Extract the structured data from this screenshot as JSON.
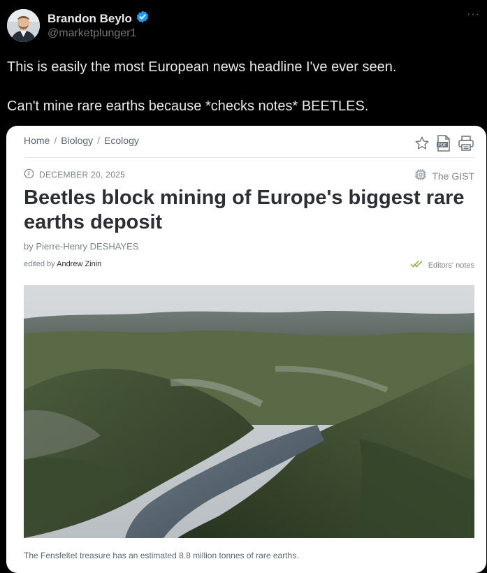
{
  "tweet": {
    "display_name": "Brandon Beylo",
    "handle": "@marketplunger1",
    "verified_icon": "verified-badge-icon",
    "more_icon": "more-options-icon",
    "text_line1": "This is easily the most European news headline I've ever seen.",
    "text_line2": "Can't mine rare earths because *checks notes* BEETLES."
  },
  "article": {
    "breadcrumb": [
      "Home",
      "Biology",
      "Ecology"
    ],
    "breadcrumb_sep": "/",
    "icons": [
      "star-icon",
      "pdf-icon",
      "print-icon"
    ],
    "date": "DECEMBER 20, 2025",
    "gist_label": "The GIST",
    "headline": "Beetles block mining of Europe's biggest rare earths deposit",
    "byline": "by Pierre-Henry DESHAYES",
    "edited_by_label": "edited by",
    "editor": "Andrew Zinin",
    "editors_notes": "Editors' notes",
    "caption": "The Fensfeltet treasure has an estimated 8.8 million tonnes of rare earths."
  },
  "colors": {
    "background": "#000000",
    "text_primary": "#e7e9ea",
    "text_secondary": "#71767b",
    "verified_blue": "#1d9bf0",
    "card_bg": "#ffffff",
    "headline": "#2b2f33"
  }
}
